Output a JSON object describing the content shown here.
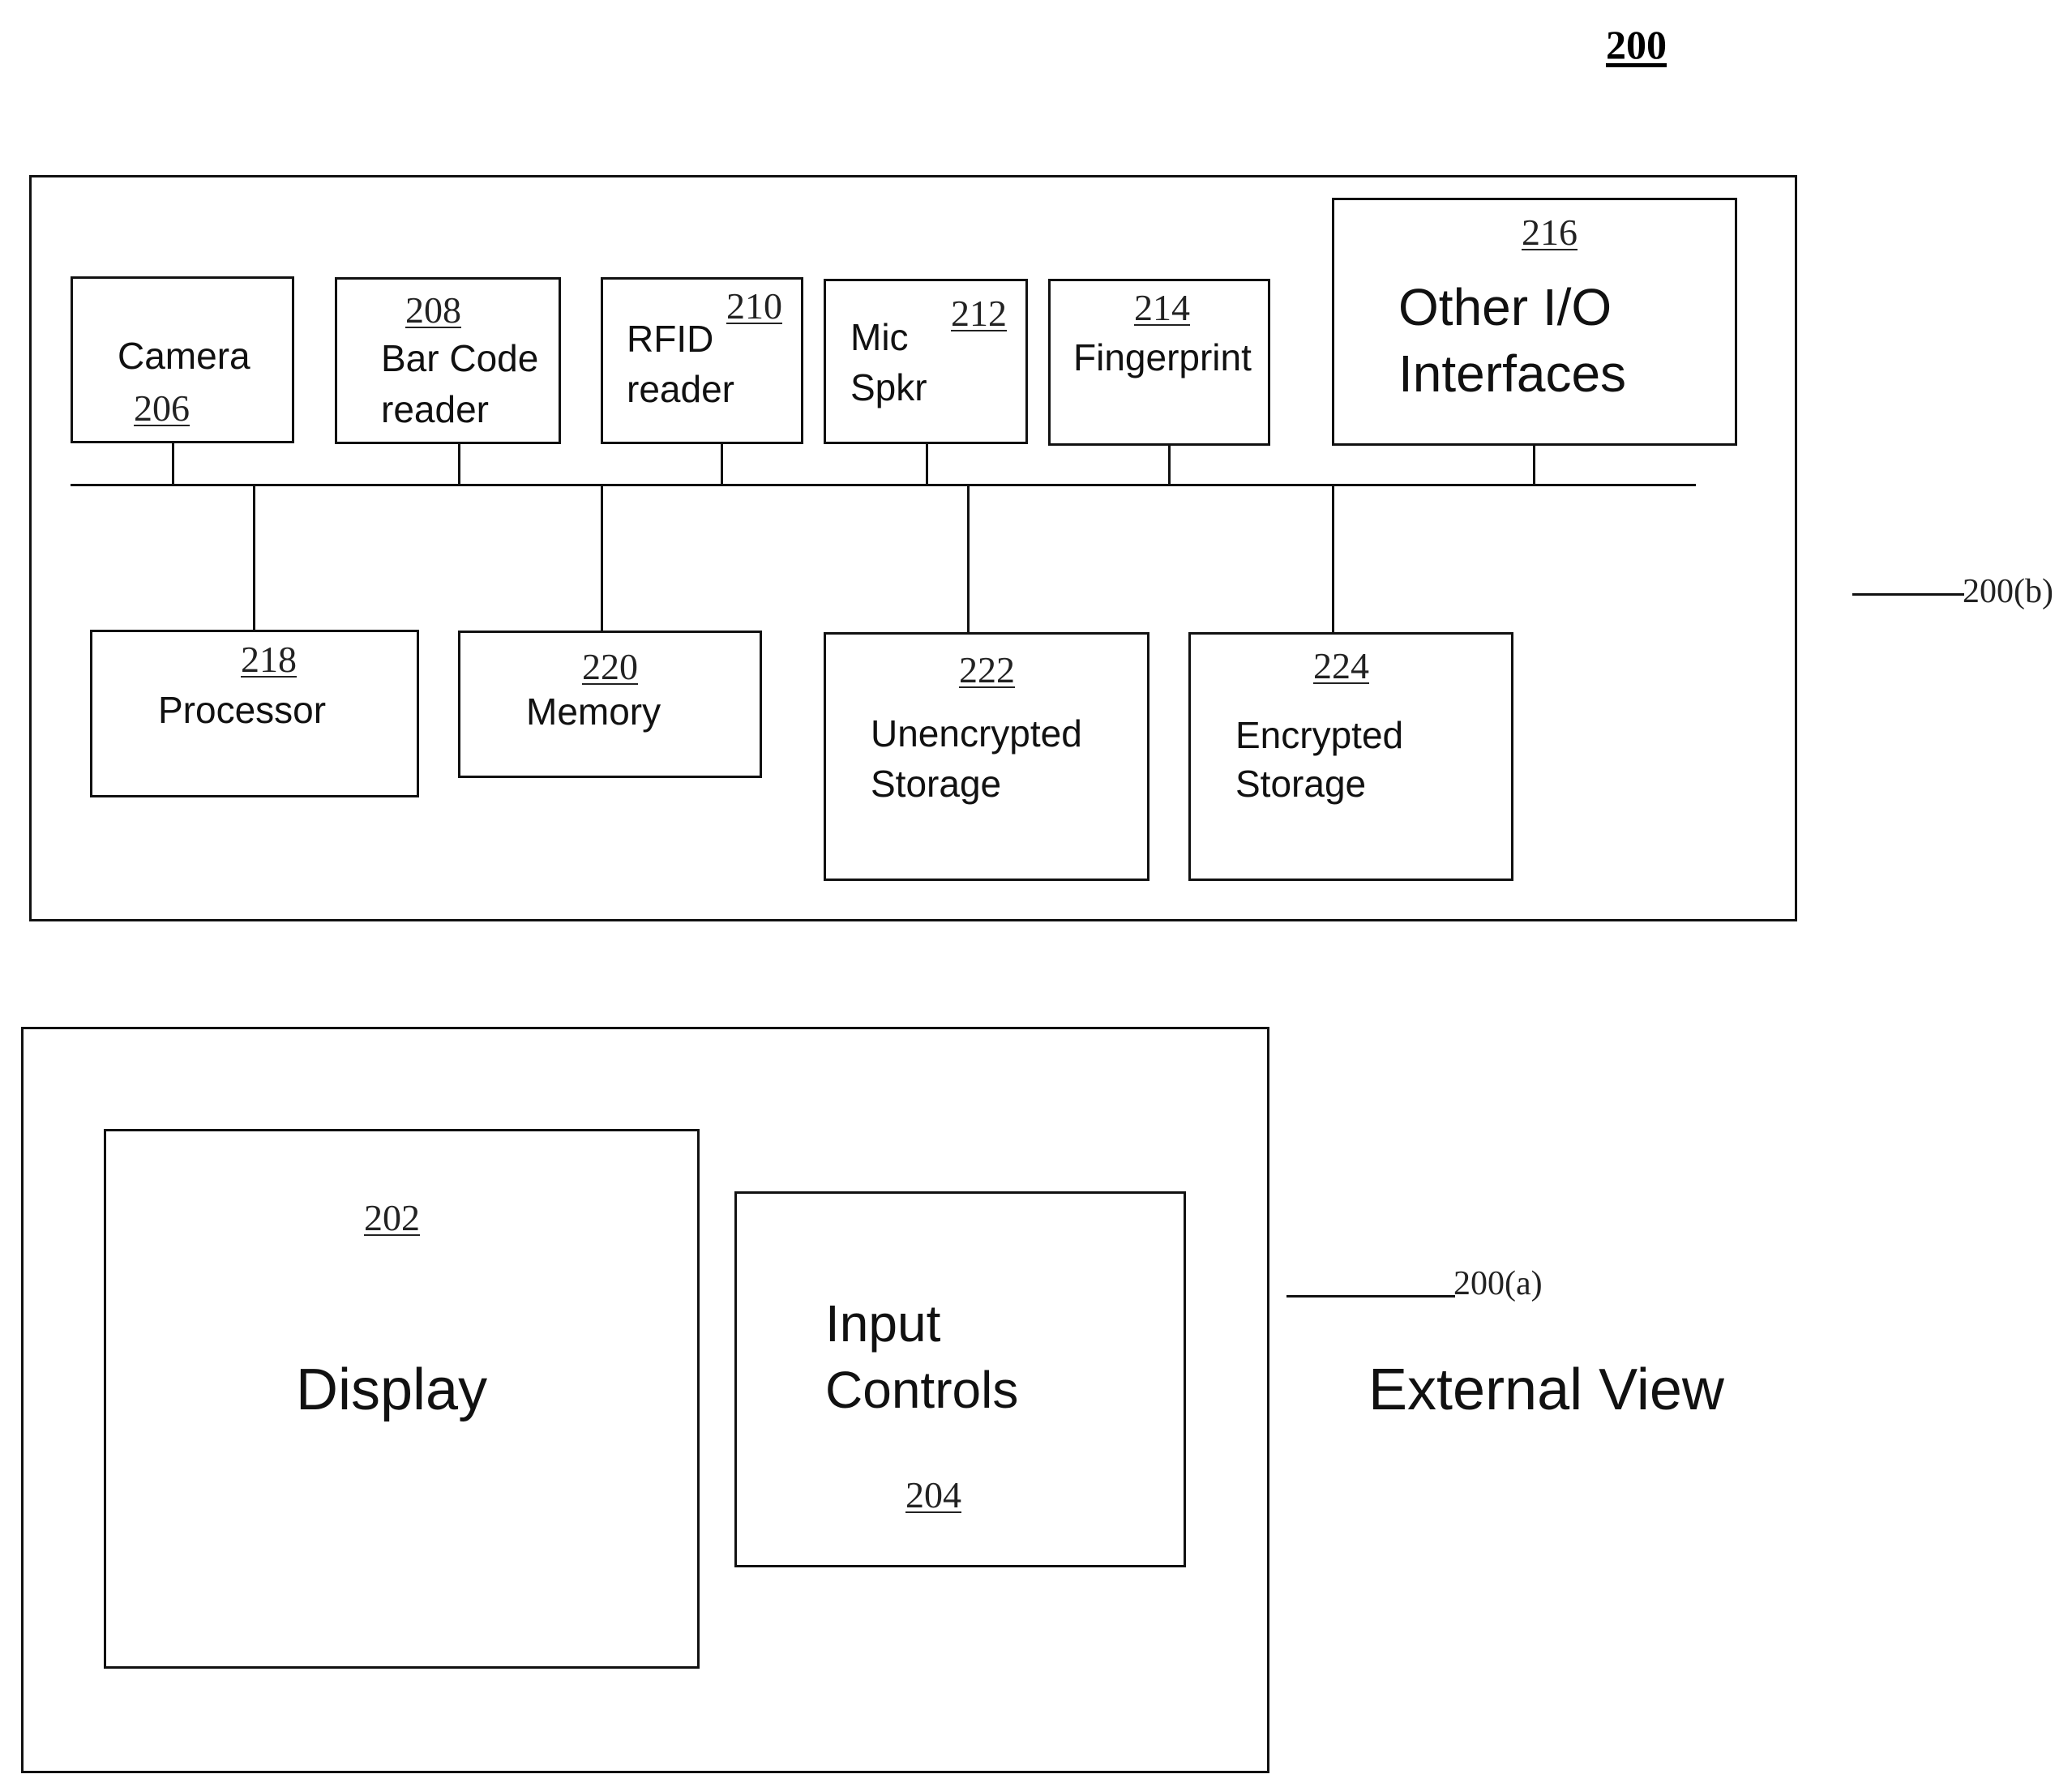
{
  "figure": {
    "number": "200"
  },
  "internal_view": {
    "callout": "200(b)",
    "io_devices": [
      {
        "ref": "206",
        "lines": [
          "Camera"
        ]
      },
      {
        "ref": "208",
        "lines": [
          "Bar Code",
          "reader"
        ]
      },
      {
        "ref": "210",
        "lines": [
          "RFID",
          "reader"
        ]
      },
      {
        "ref": "212",
        "lines": [
          "Mic",
          "Spkr"
        ]
      },
      {
        "ref": "214",
        "lines": [
          "Fingerprint"
        ]
      },
      {
        "ref": "216",
        "lines": [
          "Other I/O",
          "Interfaces"
        ]
      }
    ],
    "core_components": [
      {
        "ref": "218",
        "lines": [
          "Processor"
        ]
      },
      {
        "ref": "220",
        "lines": [
          "Memory"
        ]
      },
      {
        "ref": "222",
        "lines": [
          "Unencrypted",
          "Storage"
        ]
      },
      {
        "ref": "224",
        "lines": [
          "Encrypted",
          "Storage"
        ]
      }
    ]
  },
  "external_view": {
    "callout": "200(a)",
    "title": "External View",
    "display": {
      "ref": "202",
      "label": "Display"
    },
    "input_controls": {
      "ref": "204",
      "lines": [
        "Input",
        "Controls"
      ]
    }
  }
}
